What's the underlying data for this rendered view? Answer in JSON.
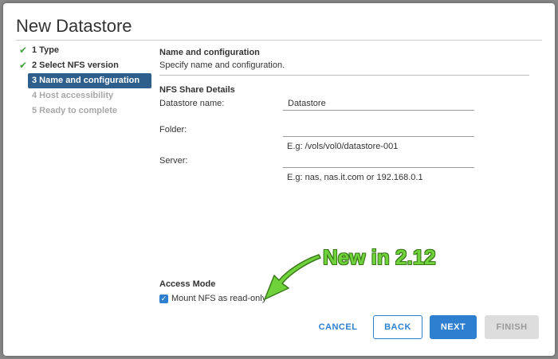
{
  "dialog": {
    "title": "New Datastore"
  },
  "steps": [
    {
      "label": "1 Type",
      "state": "done"
    },
    {
      "label": "2 Select NFS version",
      "state": "done"
    },
    {
      "label": "3 Name and configuration",
      "state": "active"
    },
    {
      "label": "4 Host accessibility",
      "state": "disabled"
    },
    {
      "label": "5 Ready to complete",
      "state": "disabled"
    }
  ],
  "main": {
    "section_title": "Name and configuration",
    "section_desc": "Specify name and configuration.",
    "nfs_details_title": "NFS Share Details",
    "datastore_name": {
      "label": "Datastore name:",
      "value": "Datastore"
    },
    "folder": {
      "label": "Folder:",
      "value": "",
      "hint": "E.g: /vols/vol0/datastore-001"
    },
    "server": {
      "label": "Server:",
      "value": "",
      "hint": "E.g: nas, nas.it.com or 192.168.0.1"
    },
    "access_mode_title": "Access Mode",
    "readonly": {
      "label": "Mount NFS as read-only",
      "checked": true
    }
  },
  "annotation": {
    "text": "New in 2.12",
    "color": "#6fd23a"
  },
  "buttons": {
    "cancel": "CANCEL",
    "back": "BACK",
    "next": "NEXT",
    "finish": "FINISH"
  },
  "colors": {
    "accent": "#2e7fcf",
    "active_step": "#2e5f8c",
    "check": "#41a43f"
  }
}
